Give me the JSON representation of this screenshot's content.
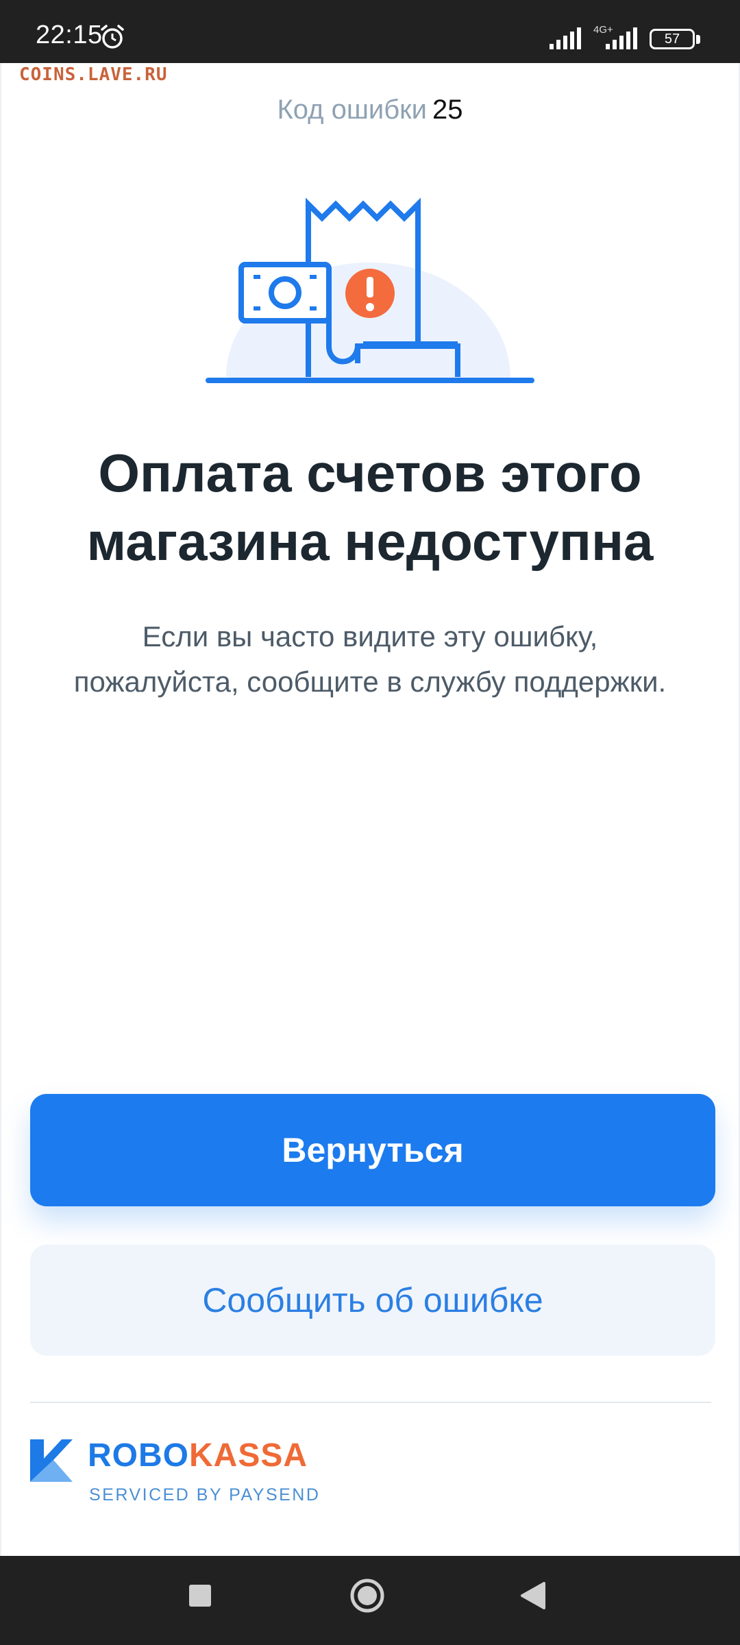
{
  "status_bar": {
    "time": "22:15",
    "network_label": "4G+",
    "battery": "57",
    "icons": [
      "alarm-icon",
      "signal-icon",
      "battery-icon"
    ]
  },
  "watermark": "COINS.LAVE.RU",
  "error": {
    "code_label": "Код ошибки",
    "code_value": "25"
  },
  "title_lines": [
    "Оплата счетов этого",
    "магазина недоступна"
  ],
  "description_lines": [
    "Если вы часто видите эту ошибку,",
    "пожалуйста, сообщите в службу поддержки."
  ],
  "buttons": {
    "back_label": "Вернуться",
    "report_label": "Сообщить об ошибке"
  },
  "footer": {
    "brand_part1": "ROBO",
    "brand_part2": "KASSA",
    "tagline": "SERVICED BY PAYSEND"
  },
  "nav_icons": [
    "recents-icon",
    "home-icon",
    "back-icon"
  ],
  "colors": {
    "primary": "#1c7bee",
    "secondary_bg": "#f0f5fc",
    "alert": "#f46b3e",
    "brand_orange": "#ef6a36"
  }
}
